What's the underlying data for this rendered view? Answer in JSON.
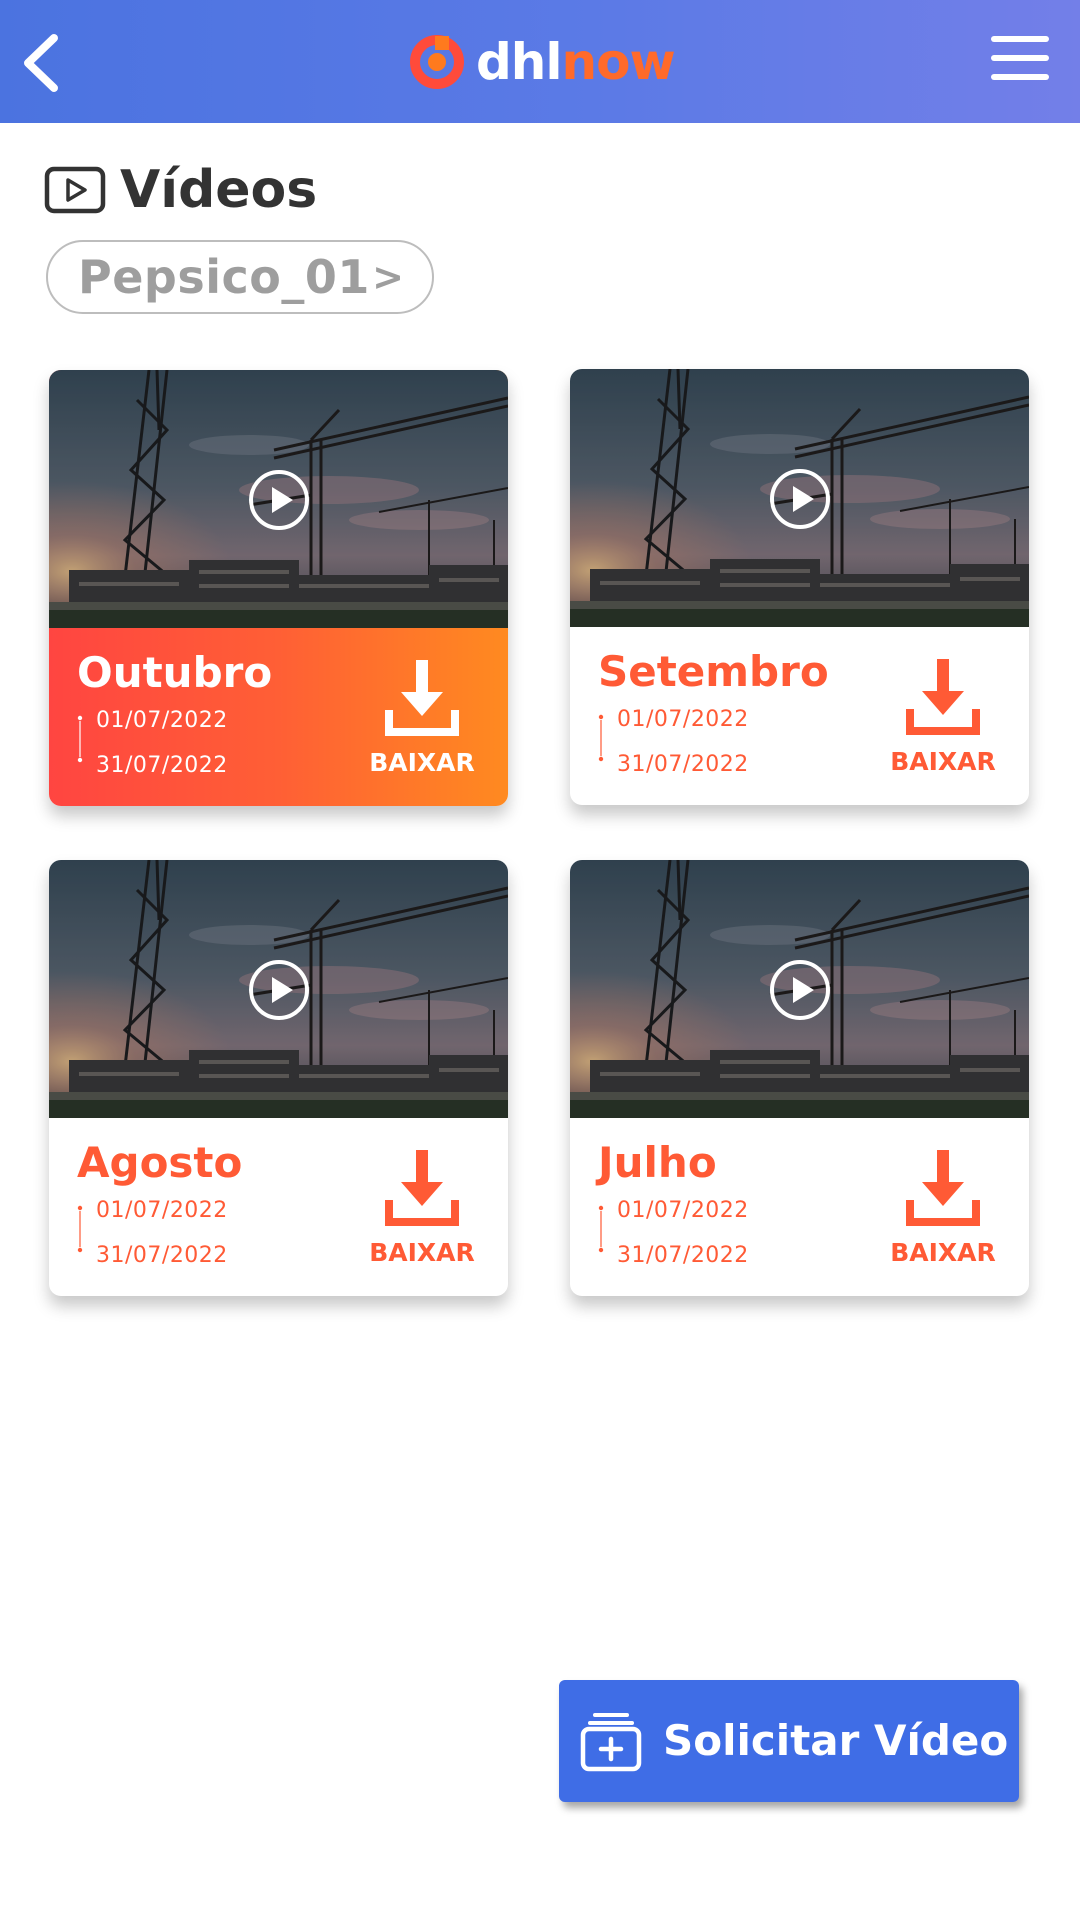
{
  "header": {
    "logo_part1": "dhl",
    "logo_part2": "now",
    "back_icon": "chevron-left-icon",
    "menu_icon": "hamburger-menu-icon",
    "colors": {
      "gradient_start": "#4b73e0",
      "gradient_end": "#737fe8",
      "logo_accent": "#ff6a2a"
    }
  },
  "page": {
    "title": "Vídeos",
    "title_icon": "video-play-icon",
    "project": {
      "name": "Pepsico_01",
      "arrow": ">"
    }
  },
  "videos": [
    {
      "month": "Outubro",
      "start_date": "01/07/2022",
      "end_date": "31/07/2022",
      "download_label": "BAIXAR",
      "active": true
    },
    {
      "month": "Setembro",
      "start_date": "01/07/2022",
      "end_date": "31/07/2022",
      "download_label": "BAIXAR",
      "active": false
    },
    {
      "month": "Agosto",
      "start_date": "01/07/2022",
      "end_date": "31/07/2022",
      "download_label": "BAIXAR",
      "active": false
    },
    {
      "month": "Julho",
      "start_date": "01/07/2022",
      "end_date": "31/07/2022",
      "download_label": "BAIXAR",
      "active": false
    }
  ],
  "actions": {
    "request_video_label": "Solicitar Vídeo",
    "request_icon": "add-stack-icon"
  },
  "colors": {
    "accent": "#ff5a35",
    "primary_blue": "#3f6de6",
    "active_card_gradient": [
      "#ff4541",
      "#ff8a20"
    ]
  }
}
